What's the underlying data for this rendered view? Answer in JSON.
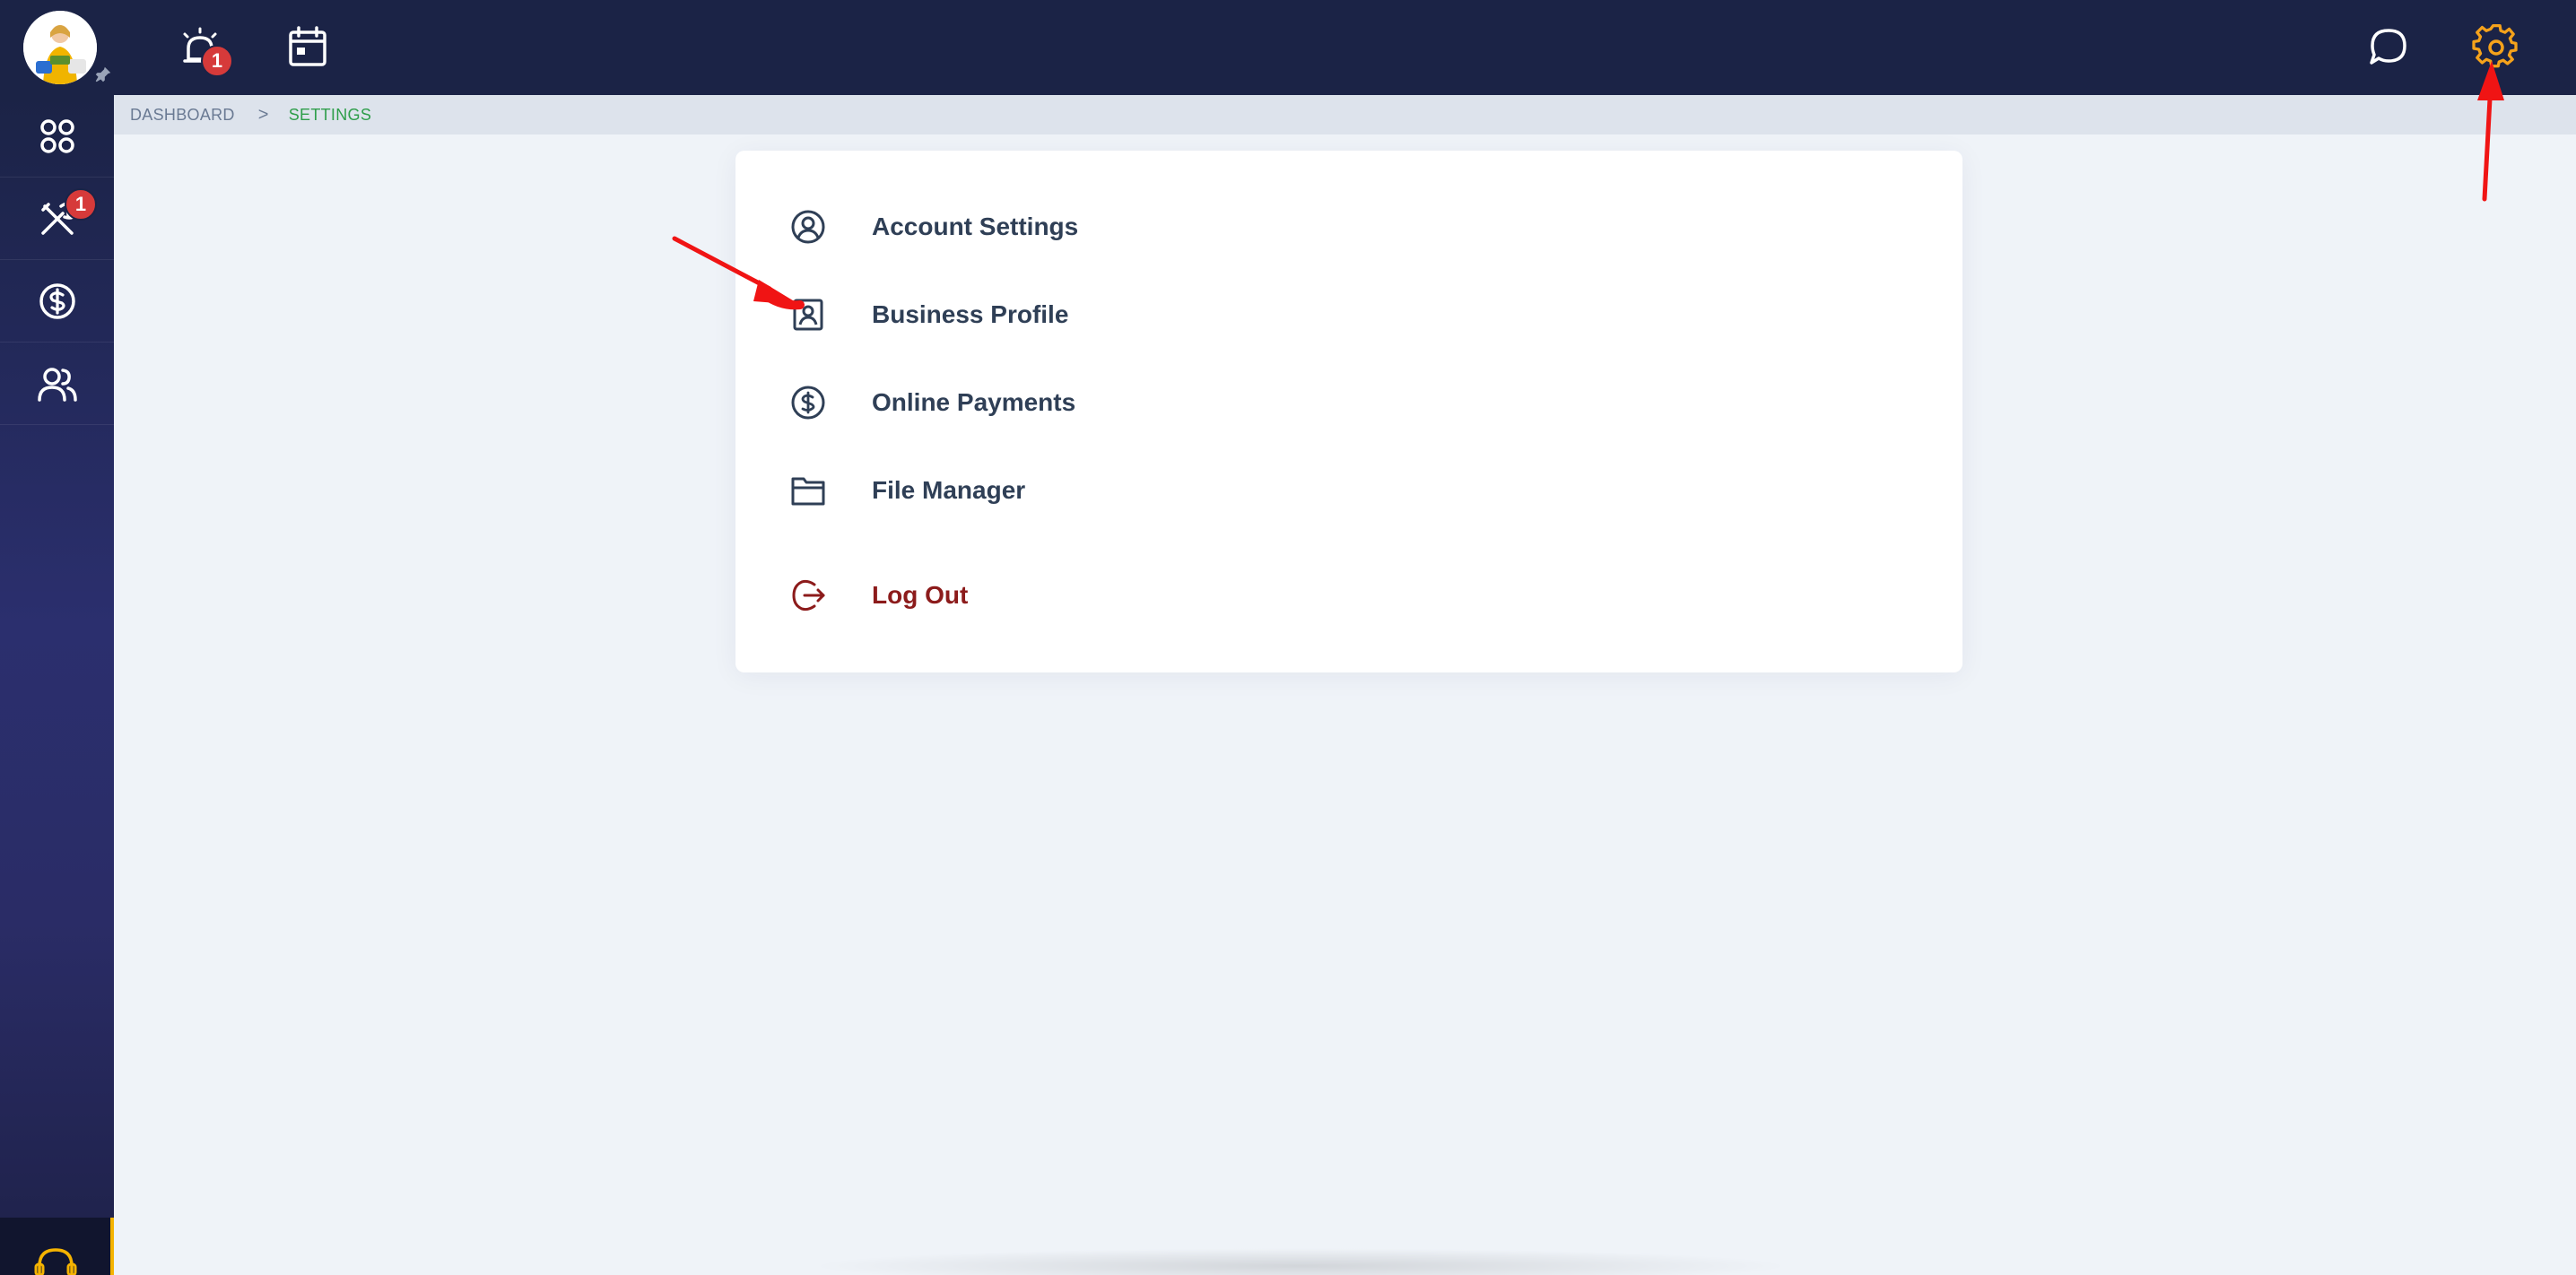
{
  "breadcrumb": {
    "items": [
      "DASHBOARD",
      "SETTINGS"
    ],
    "separator": ">"
  },
  "topbar": {
    "alerts_badge": "1"
  },
  "sidebar": {
    "tools_badge": "1"
  },
  "settings_menu": {
    "items": [
      {
        "label": "Account Settings",
        "icon": "user-circle-icon"
      },
      {
        "label": "Business Profile",
        "icon": "id-badge-icon"
      },
      {
        "label": "Online Payments",
        "icon": "dollar-circle-icon"
      },
      {
        "label": "File Manager",
        "icon": "folder-icon"
      }
    ],
    "logout_label": "Log Out"
  },
  "colors": {
    "topbar_bg": "#1b2346",
    "accent_gear": "#f5a21b",
    "breadcrumb_active": "#2e9e4a",
    "logout": "#8c1b1b",
    "badge": "#d63a3a"
  }
}
